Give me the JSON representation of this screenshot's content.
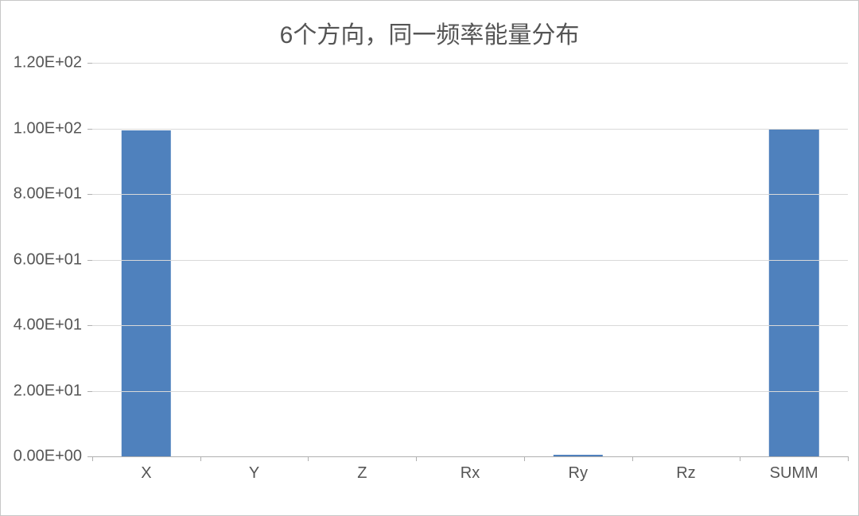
{
  "chart_data": {
    "type": "bar",
    "title": "6个方向，同一频率能量分布",
    "categories": [
      "X",
      "Y",
      "Z",
      "Rx",
      "Ry",
      "Rz",
      "SUMM"
    ],
    "values": [
      99.5,
      0.0,
      0.0,
      0.0,
      0.5,
      0.0,
      100.0
    ],
    "ylim": [
      0,
      120
    ],
    "y_ticks": [
      0,
      20,
      40,
      60,
      80,
      100,
      120
    ],
    "y_tick_labels": [
      "0.00E+00",
      "2.00E+01",
      "4.00E+01",
      "6.00E+01",
      "8.00E+01",
      "1.00E+02",
      "1.20E+02"
    ],
    "bar_color": "#4f81bd",
    "grid_color": "#d9d9d9",
    "xlabel": "",
    "ylabel": ""
  }
}
